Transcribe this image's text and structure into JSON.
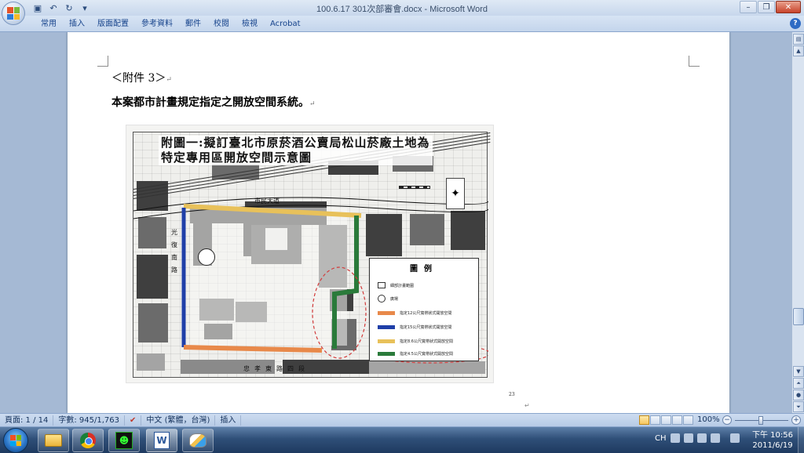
{
  "window": {
    "title": "100.6.17 301次部審會.docx - Microsoft Word"
  },
  "ribbon": {
    "tabs": [
      "常用",
      "插入",
      "版面配置",
      "參考資料",
      "郵件",
      "校閱",
      "檢視",
      "Acrobat"
    ]
  },
  "document": {
    "line1": "＜附件 3＞",
    "line2": "本案都市計畫規定指定之開放空間系統。",
    "paragraph_mark": "↵",
    "page_number": "23",
    "figure": {
      "title_line1": "附圖一:擬訂臺北市原菸酒公賣局松山菸廠土地為",
      "title_line2": "特定專用區開放空間示意圖",
      "road_top": "市民大道",
      "road_bottom": "忠孝東路四段",
      "road_left": "光復南路",
      "legend_title": "圖例",
      "legend_items": [
        {
          "label": "細部計畫範圍",
          "color": "#ffffff"
        },
        {
          "label": "廣場",
          "color": "#ffffff"
        },
        {
          "label": "指定12公尺寬帶狀式開放空間",
          "color": "#e8894a"
        },
        {
          "label": "指定15公尺寬帶狀式開放空間",
          "color": "#1f3fa8"
        },
        {
          "label": "指定8.6公尺寬帶狀式開放空間",
          "color": "#e8c15a"
        },
        {
          "label": "指定4.5公尺寬帶狀式開放空間",
          "color": "#2a7a3a"
        }
      ]
    }
  },
  "statusbar": {
    "page": "頁面: 1 / 14",
    "words": "字數: 945/1,763",
    "language": "中文 (繁體，台灣)",
    "mode": "插入",
    "zoom": "100%"
  },
  "taskbar": {
    "apps": [
      "folder-icon",
      "chrome-icon",
      "game-icon",
      "word-icon",
      "paint-icon"
    ],
    "language": "CH",
    "time": "下午 10:56",
    "date": "2011/6/19"
  },
  "colors": {
    "orange": "#e8894a",
    "blue": "#1f3fa8",
    "yellow": "#e8c15a",
    "green": "#2a7a3a",
    "dashed_red": "#d23a3a"
  }
}
